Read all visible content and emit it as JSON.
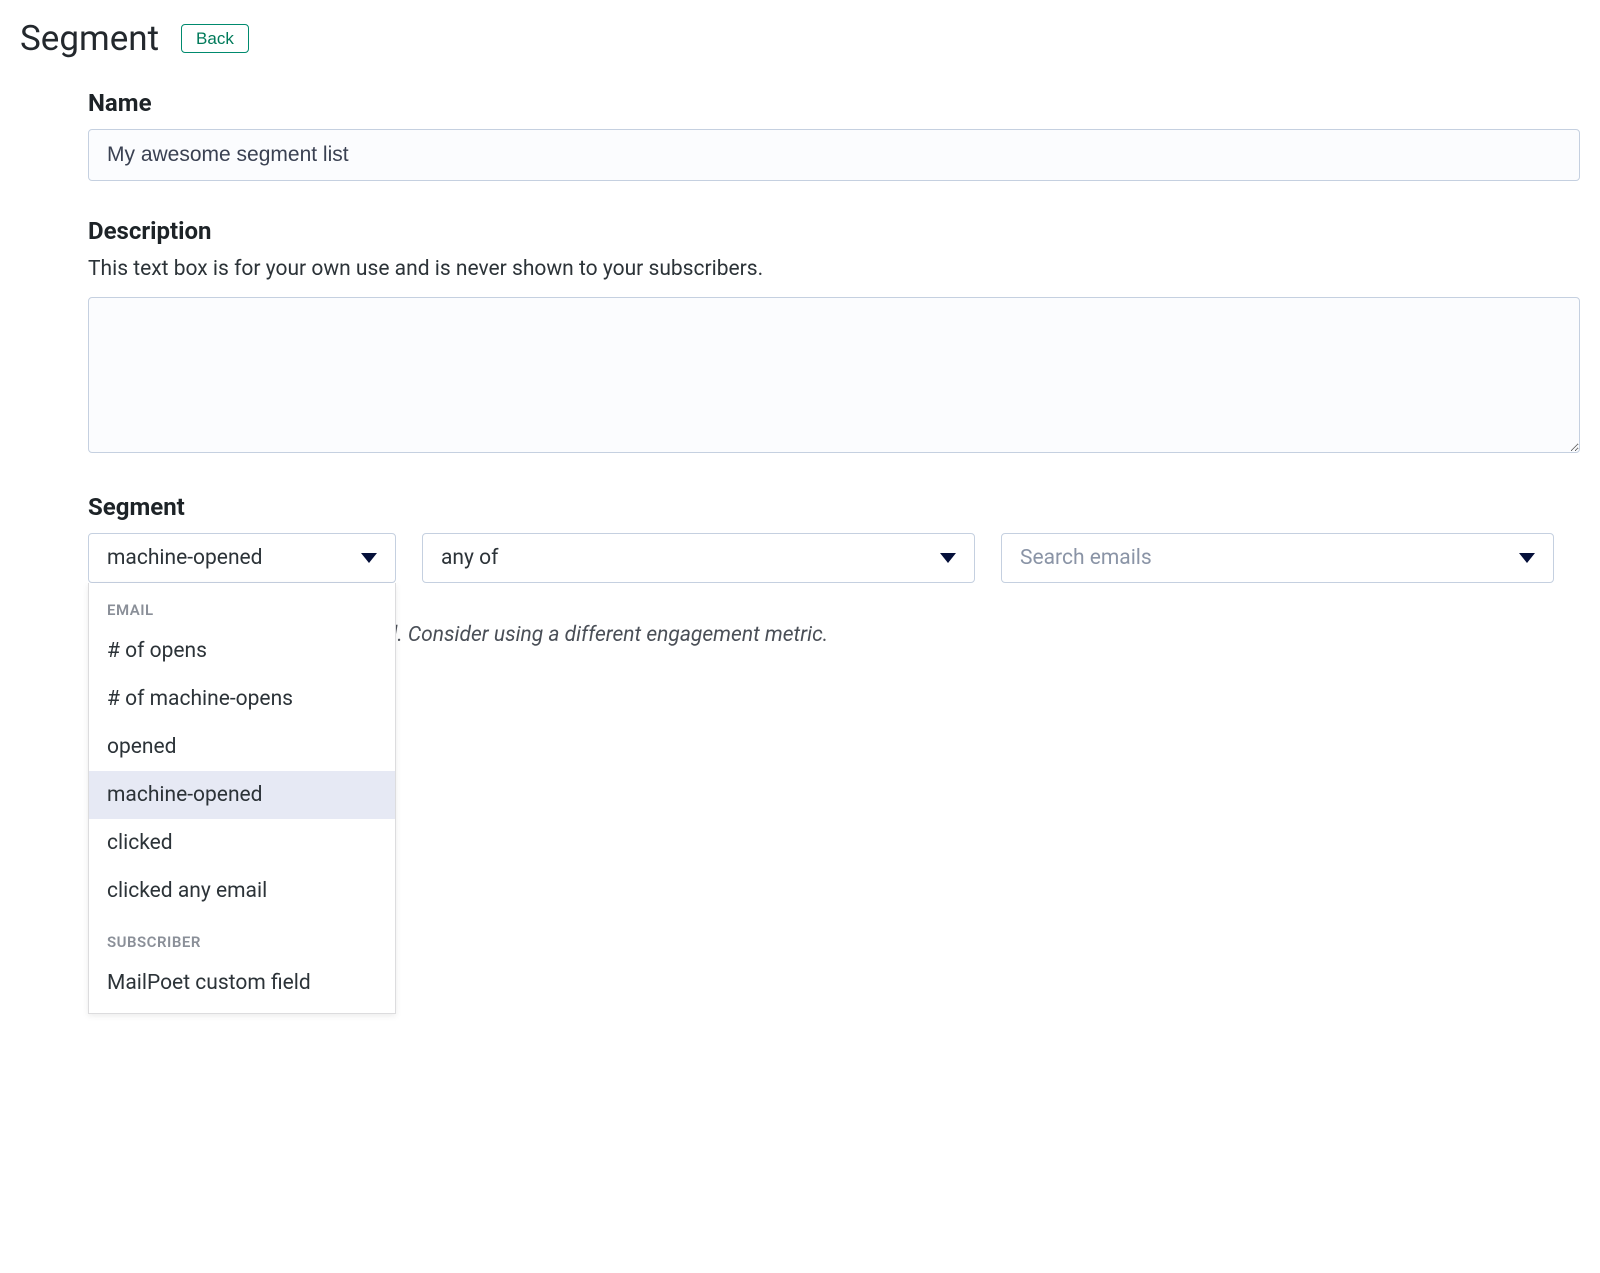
{
  "header": {
    "title": "Segment",
    "back_label": "Back"
  },
  "name_section": {
    "label": "Name",
    "value": "My awesome segment list"
  },
  "description_section": {
    "label": "Description",
    "hint": "This text box is for your own use and is never shown to your subscribers.",
    "value": ""
  },
  "segment_section": {
    "label": "Segment",
    "select1_value": "machine-opened",
    "select2_value": "any of",
    "select3_placeholder": "Search emails",
    "dropdown": {
      "group1_label": "EMAIL",
      "group1_items": [
        "# of opens",
        "# of machine-opens",
        "opened",
        "machine-opened",
        "clicked",
        "clicked any email"
      ],
      "group1_highlighted_index": 3,
      "group2_label": "SUBSCRIBER",
      "group2_items": [
        "MailPoet custom field"
      ]
    },
    "note_text": "s, some opens may not be tracked. Consider using a different engagement metric."
  }
}
